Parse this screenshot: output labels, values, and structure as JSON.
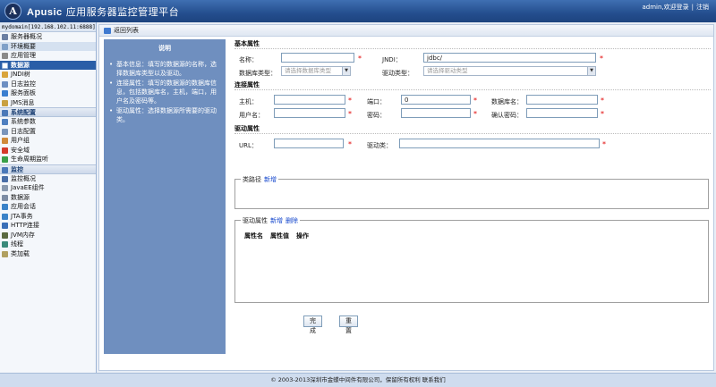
{
  "header": {
    "logo_letter": "A",
    "brand": "Apusic",
    "title": "应用服务器监控管理平台",
    "user": "admin,欢迎登录",
    "separator": "|",
    "logout": "注销"
  },
  "sidebar": {
    "domain": "mydomain[192.168.102.11:6888]",
    "group1": [
      {
        "label": "服务器概况",
        "icon": "server-icon",
        "color": "#6b7fa3"
      },
      {
        "label": "环境概要",
        "icon": "environment-icon",
        "color": "#7fa0c8"
      },
      {
        "label": "应用管理",
        "icon": "application-icon",
        "color": "#8a8a8a"
      },
      {
        "label": "数据源",
        "icon": "datasource-icon",
        "color": "#ffffff"
      },
      {
        "label": "JNDI树",
        "icon": "jndi-tree-icon",
        "color": "#d9a43a"
      },
      {
        "label": "日志监控",
        "icon": "log-monitor-icon",
        "color": "#6d8fc2"
      },
      {
        "label": "服务面板",
        "icon": "service-panel-icon",
        "color": "#3a7fd0"
      },
      {
        "label": "JMS消息",
        "icon": "jms-icon",
        "color": "#c9a040"
      }
    ],
    "section_config": "系统配置",
    "group2": [
      {
        "label": "系统参数",
        "icon": "system-params-icon",
        "color": "#4e7fc0"
      },
      {
        "label": "日志配置",
        "icon": "log-config-icon",
        "color": "#7a95bb"
      },
      {
        "label": "用户组",
        "icon": "user-group-icon",
        "color": "#d08a3a"
      },
      {
        "label": "安全域",
        "icon": "security-domain-icon",
        "color": "#d43a2a"
      },
      {
        "label": "生命周期监听",
        "icon": "lifecycle-icon",
        "color": "#3aa04a"
      }
    ],
    "section_monitor": "监控",
    "group3": [
      {
        "label": "监控概况",
        "icon": "monitor-overview-icon",
        "color": "#4a6fa8"
      },
      {
        "label": "JavaEE组件",
        "icon": "javaee-icon",
        "color": "#8a9ab0"
      },
      {
        "label": "数据源",
        "icon": "datasource-monitor-icon",
        "color": "#7d8da5"
      },
      {
        "label": "应用会话",
        "icon": "session-icon",
        "color": "#3a82c8"
      },
      {
        "label": "JTA事务",
        "icon": "jta-icon",
        "color": "#3a82c8"
      },
      {
        "label": "HTTP连接",
        "icon": "http-icon",
        "color": "#3a6fb8"
      },
      {
        "label": "JVM内存",
        "icon": "jvm-memory-icon",
        "color": "#5a6a40"
      },
      {
        "label": "线程",
        "icon": "thread-icon",
        "color": "#3a8a7a"
      },
      {
        "label": "类加载",
        "icon": "classloader-icon",
        "color": "#b0a060"
      }
    ]
  },
  "main": {
    "back_label": "返回列表",
    "desc_title": "说明",
    "desc_items": [
      "基本信息：填写的数据源的名称，选择数据库类型以及驱动。",
      "连接属性：填写的数据源的数据库信息，包括数据库名，主机，端口，用户名及密码等。",
      "驱动属性：选择数据源所需要的驱动类。"
    ],
    "basic": {
      "title": "基本属性",
      "name_label": "名称：",
      "name_value": "",
      "jndi_label": "JNDI：",
      "jndi_value": "jdbc/",
      "dbtype_label": "数据库类型：",
      "dbtype_placeholder": "请选择数据库类型",
      "drivertype_label": "驱动类型：",
      "drivertype_placeholder": "请选择驱动类型"
    },
    "conn": {
      "title": "连接属性",
      "host_label": "主机：",
      "port_label": "端口：",
      "port_value": "0",
      "dbname_label": "数据库名：",
      "user_label": "用户名：",
      "pwd_label": "密码：",
      "confirm_label": "确认密码："
    },
    "driver": {
      "title": "驱动属性",
      "url_label": "URL：",
      "class_label": "驱动类："
    },
    "classpath": {
      "legend": "类路径",
      "add": "新增"
    },
    "props": {
      "legend": "驱动属性",
      "add": "新增",
      "delete": "删除",
      "col_name": "属性名",
      "col_value": "属性值",
      "col_action": "操作"
    },
    "buttons": {
      "finish": "完成",
      "reset": "重置"
    },
    "required_mark": "*"
  },
  "footer": {
    "text": "© 2003-2013深圳市金蝶中间件有限公司，保留所有权利 联系我们"
  }
}
